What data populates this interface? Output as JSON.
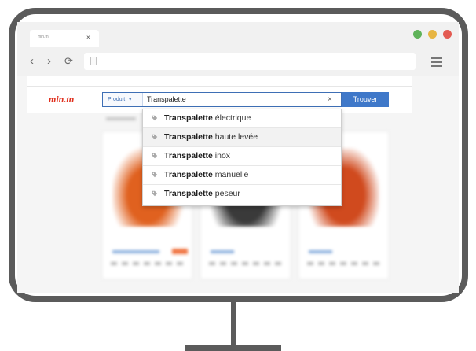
{
  "browser": {
    "tab_title": "min.tn",
    "tab_close": "×",
    "window_dots": [
      {
        "name": "green",
        "color": "#5fb35a"
      },
      {
        "name": "yellow",
        "color": "#e7b542"
      },
      {
        "name": "red",
        "color": "#e35b52"
      }
    ],
    "nav": {
      "back": "‹",
      "forward": "›",
      "reload": "⟳"
    },
    "icons": [
      "page-icon",
      "menu-icon"
    ]
  },
  "site": {
    "logo": "min.tn",
    "logo_color": "#e0301e",
    "accent_color": "#3f78c9"
  },
  "search": {
    "category": "Produit",
    "query": "Transpalette",
    "clear": "×",
    "submit": "Trouver"
  },
  "suggestions": [
    {
      "bold": "Transpalette",
      "rest": " électrique",
      "highlighted": false
    },
    {
      "bold": "Transpalette",
      "rest": " haute levée",
      "highlighted": true
    },
    {
      "bold": "Transpalette",
      "rest": " inox",
      "highlighted": false
    },
    {
      "bold": "Transpalette",
      "rest": " manuelle",
      "highlighted": false
    },
    {
      "bold": "Transpalette",
      "rest": " peseur",
      "highlighted": false
    }
  ],
  "products": {
    "blurred": true,
    "count": 3,
    "colors": [
      "#e0611f",
      "#3a3a3a",
      "#d04a1e"
    ]
  }
}
